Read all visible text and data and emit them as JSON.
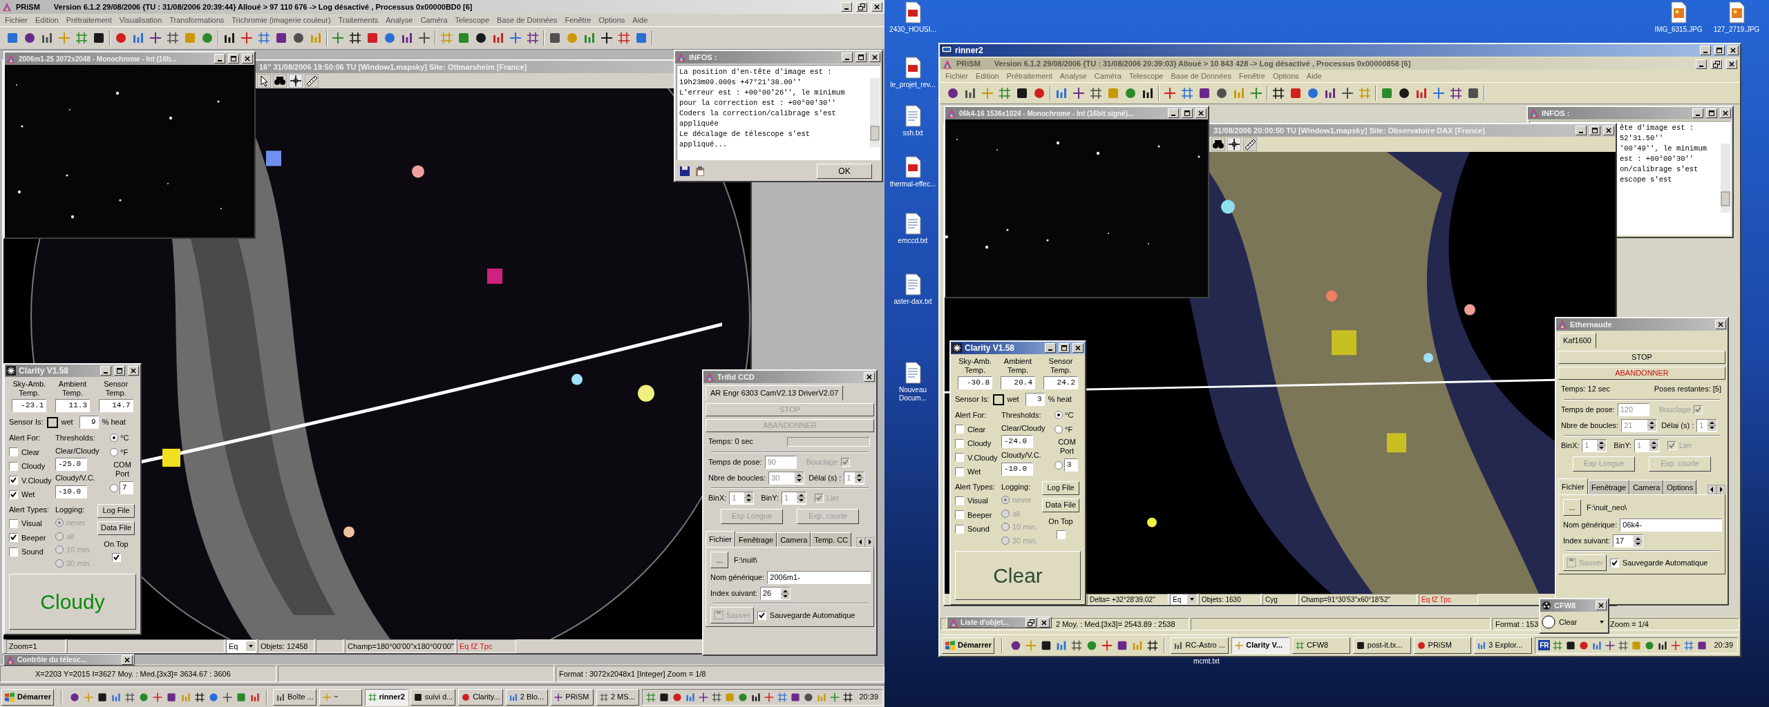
{
  "screens": [
    {
      "app": {
        "name": "PRiSM",
        "title": "Version 6.1.2   29/08/2006   {TU : 31/08/2006 20:39:44} Alloué > 97 110 676 -> Log désactivé , Processus 0x00000BD0 [6]",
        "menu": [
          "Fichier",
          "Edition",
          "Prétraitement",
          "Visualisation",
          "Transformations",
          "Trichromie (imagerie couleur)",
          "Traitements",
          "Analyse",
          "Caméra",
          "Telescope",
          "Base de Données",
          "Fenêtre",
          "Options",
          "Aide"
        ]
      },
      "map_window": {
        "title": "16\"  31/08/2006 19:50:06 TU [Window1.mapsky]  Site: Ottmarsheim [France]",
        "status": [
          {
            "text": "Zoom=1",
            "kind": "text"
          },
          {
            "text": "Eq",
            "kind": "dropdown"
          },
          {
            "text": "Objets: 12458",
            "kind": "text"
          },
          {
            "text": "Champ=180°00'00\"x180°00'00\"",
            "kind": "text"
          },
          {
            "text": "Eq fZ Tpc",
            "kind": "alert"
          }
        ]
      },
      "image_window": {
        "title": "2006m1-25 3072x2048 - Monochrome - Int (16b..."
      },
      "infos": {
        "title": "INFOS :",
        "lines": [
          "La position d'en-tête d'image est :",
          "19h23m09.000s +47°21'38.00''",
          "L'erreur est : +00°00'26'', le minimum",
          "pour la correction est : +00°00'30''",
          "Coders la correction/calibrage s'est",
          "appliquée",
          "Le décalage de télescope s'est",
          "appliqué..."
        ],
        "ok": "OK"
      },
      "clarity": {
        "title": "Clarity  V1.58",
        "temps": [
          {
            "label": "Sky-Amb. Temp.",
            "value": "-23.1"
          },
          {
            "label": "Ambient Temp.",
            "value": "11.3"
          },
          {
            "label": "Sensor Temp.",
            "value": "14.7"
          }
        ],
        "sensor_label": "Sensor Is:",
        "wet_label": "wet",
        "heat": "9",
        "heat_label": "% heat",
        "alert_for": {
          "label": "Alert For:",
          "items": [
            {
              "label": "Clear",
              "checked": false
            },
            {
              "label": "Cloudy",
              "checked": false
            },
            {
              "label": "V.Cloudy",
              "checked": true
            },
            {
              "label": "Wet",
              "checked": true
            }
          ]
        },
        "thresholds": {
          "label": "Thresholds:",
          "clear_cloudy_label": "Clear/Cloudy",
          "clear_cloudy": "-25.0",
          "cloudy_vc_label": "Cloudy/V.C.",
          "cloudy_vc": "-10.0"
        },
        "units": [
          {
            "label": "°C",
            "selected": true
          },
          {
            "label": "°F",
            "selected": false
          }
        ],
        "com_label": "COM Port",
        "com_selected": false,
        "com": "7",
        "alert_types": {
          "label": "Alert Types:",
          "items": [
            {
              "label": "Visual",
              "checked": false
            },
            {
              "label": "Beeper",
              "checked": true
            },
            {
              "label": "Sound",
              "checked": false
            }
          ]
        },
        "logging": {
          "label": "Logging:",
          "disabled": true,
          "items": [
            {
              "label": "never",
              "selected": true
            },
            {
              "label": "all",
              "selected": false
            },
            {
              "label": "10 min.",
              "selected": false
            },
            {
              "label": "30 min.",
              "selected": false
            }
          ]
        },
        "buttons": [
          "Log File",
          "Data File"
        ],
        "on_top": {
          "label": "On Top",
          "checked": true
        },
        "status": "Cloudy"
      },
      "camera": {
        "title": "Trifid CCD",
        "tab": "AR Engr 6303 CamV2.13 DriverV2.07",
        "buttons": [
          {
            "label": "STOP",
            "kind": "stop",
            "disabled": true
          },
          {
            "label": "ABANDONNER",
            "kind": "abort",
            "disabled": true
          }
        ],
        "time": "Temps:  0 sec",
        "progress": {
          "level": 0
        },
        "exposure_label": "Temps de pose:",
        "exposure": "90",
        "loop_label": "Bouclage",
        "loop": true,
        "count_label": "Nbre de boucles:",
        "count": "30",
        "delay_label": "Délai (s) :",
        "delay": "1",
        "binx_label": "BinX:",
        "binx": "1",
        "biny_label": "BinY:",
        "biny": "1",
        "link_label": "Lier",
        "link": true,
        "exp_buttons": [
          "Exp Longue",
          "Exp. courte"
        ],
        "tabs": [
          {
            "label": "Fichier",
            "selected": true
          },
          {
            "label": "Fenêtrage",
            "selected": false
          },
          {
            "label": "Camera",
            "selected": false
          },
          {
            "label": "Temp. CC",
            "selected": false
          }
        ],
        "browse": "...",
        "path": "F:\\nuit\\",
        "name_label": "Nom générique:",
        "name": "2006m1-",
        "index_label": "Index suivant:",
        "index": "26",
        "save": "Sauver",
        "autosave_label": "Sauvegarde Automatique",
        "autosave": true
      },
      "minimized": [
        {
          "title": "Contrôle du télesc..."
        }
      ],
      "status_bar": [
        "X=2203 Y=2015 I=3627  Moy. : Med.[3x3]= 3634.67 : 3606",
        "Format : 3072x2048x1 [Integer]  Zoom = 1/8"
      ],
      "taskbar": {
        "start": "Démarrer",
        "tasks": [
          {
            "label": "Boîte ...",
            "selected": false
          },
          {
            "label": "~",
            "selected": false
          },
          {
            "label": "rinner2",
            "selected": true
          },
          {
            "label": "suivi d...",
            "selected": false
          },
          {
            "label": "Clarity...",
            "selected": false
          },
          {
            "label": "2 Blo...",
            "selected": false
          },
          {
            "label": "PRiSM",
            "selected": false
          },
          {
            "label": "2 MS...",
            "selected": false
          }
        ],
        "time": "20:39"
      }
    },
    {
      "vnc_window": {
        "title": "rinner2"
      },
      "app": {
        "name": "PRiSM",
        "title": "Version 6.1.2   29/08/2006   {TU : 31/08/2006 20:39:03} Alloué > 10 843 428 -> Log désactivé , Processus 0x00000858 [6]",
        "menu": [
          "Fichier",
          "Edition",
          "Prétraitement",
          "Analyse",
          "Caméra",
          "Telescope",
          "Base de Données",
          "Fenêtre",
          "Options",
          "Aide"
        ]
      },
      "infos": {
        "title": "INFOS :",
        "lines": [
          "ête d'image est :",
          "52'31.50''",
          "'00'49'', le minimum",
          "est : +00°00'30''",
          "on/calibrage s'est",
          "escope s'est"
        ]
      },
      "map_window": {
        "title": "31/08/2006 20:00:50 TU [Window1.mapsky]  Site: Observatoire DAX [France]",
        "status": [
          {
            "text": "Delta= +32°28'39.02''",
            "kind": "text"
          },
          {
            "text": "Eq",
            "kind": "dropdown"
          },
          {
            "text": "Objets: 1630",
            "kind": "text"
          },
          {
            "text": "Cyg",
            "kind": "text"
          },
          {
            "text": "Champ=91°30'53''x60°18'52''",
            "kind": "text"
          },
          {
            "text": "Eq fZ Tpc",
            "kind": "alert"
          }
        ]
      },
      "image_window": {
        "title": "06k4-16 1536x1024 - Monochrome - Int (16bit signé)..."
      },
      "clarity": {
        "title": "Clarity  V1.58",
        "temps": [
          {
            "label": "Sky-Amb. Temp.",
            "value": "-30.8"
          },
          {
            "label": "Ambient Temp.",
            "value": "20.4"
          },
          {
            "label": "Sensor Temp.",
            "value": "24.2"
          }
        ],
        "sensor_label": "Sensor Is:",
        "wet_label": "wet",
        "heat": "3",
        "heat_label": "% heat",
        "alert_for": {
          "label": "Alert For:",
          "items": [
            {
              "label": "Clear",
              "checked": false
            },
            {
              "label": "Cloudy",
              "checked": false
            },
            {
              "label": "V.Cloudy",
              "checked": false
            },
            {
              "label": "Wet",
              "checked": false
            }
          ]
        },
        "thresholds": {
          "label": "Thresholds:",
          "clear_cloudy_label": "Clear/Cloudy",
          "clear_cloudy": "-24.0",
          "cloudy_vc_label": "Cloudy/V.C.",
          "cloudy_vc": "-10.0"
        },
        "units": [
          {
            "label": "°C",
            "selected": true
          },
          {
            "label": "°F",
            "selected": false
          }
        ],
        "com_label": "COM Port",
        "com_selected": false,
        "com": "3",
        "alert_types": {
          "label": "Alert Types:",
          "items": [
            {
              "label": "Visual",
              "checked": false
            },
            {
              "label": "Beeper",
              "checked": false
            },
            {
              "label": "Sound",
              "checked": false
            }
          ]
        },
        "logging": {
          "label": "Logging:",
          "disabled": true,
          "items": [
            {
              "label": "never",
              "selected": true
            },
            {
              "label": "all",
              "selected": false
            },
            {
              "label": "10 min.",
              "selected": false
            },
            {
              "label": "30 min.",
              "selected": false
            }
          ]
        },
        "buttons": [
          "Log File",
          "Data File"
        ],
        "on_top": {
          "label": "On Top",
          "checked": false
        },
        "status": "Clear"
      },
      "camera": {
        "title": "Ethernaude",
        "tab": "Kaf1600",
        "buttons": [
          {
            "label": "STOP",
            "kind": "stop",
            "disabled": false
          },
          {
            "label": "ABANDONNER",
            "kind": "abort",
            "disabled": false
          }
        ],
        "time": "Temps:  12 sec",
        "remaining": "Poses restantes: [5]",
        "exposure_label": "Temps de pose:",
        "exposure": "120",
        "loop_label": "Bouclage",
        "loop": true,
        "count_label": "Nbre de boucles:",
        "count": "21",
        "delay_label": "Délai (s) :",
        "delay": "1",
        "binx_label": "BinX:",
        "binx": "1",
        "biny_label": "BinY:",
        "biny": "1",
        "link_label": "Lier",
        "link": true,
        "exp_buttons": [
          "Exp Longue",
          "Exp. courte"
        ],
        "tabs": [
          {
            "label": "Fichier",
            "selected": true
          },
          {
            "label": "Fenêtrage",
            "selected": false
          },
          {
            "label": "Camera",
            "selected": false
          },
          {
            "label": "Options",
            "selected": false
          }
        ],
        "browse": "...",
        "path": "F:\\nuit_neo\\",
        "name_label": "Nom générique:",
        "name": "06k4-",
        "index_label": "Index suivant:",
        "index": "17",
        "save": "Sauver",
        "autosave_label": "Sauvegarde Automatique",
        "autosave": true
      },
      "minimized": [
        {
          "title": "Liste d'objet..."
        }
      ],
      "status_bar": [
        "2  Moy. : Med.[3x3]= 2543.89 : 2538",
        "Format : 153",
        "Zoom = 1/4"
      ],
      "filter_wheel": {
        "title": "CFW8",
        "value": "Clear"
      },
      "taskbar": {
        "start": "Démarrer",
        "tasks": [
          {
            "label": "RC-Astro ...",
            "selected": false
          },
          {
            "label": "Clarity V...",
            "selected": true
          },
          {
            "label": "CFW8",
            "selected": false
          },
          {
            "label": "post-it.tx...",
            "selected": false
          },
          {
            "label": "PRiSM",
            "selected": false
          },
          {
            "label": "3 Explor...",
            "selected": false
          }
        ],
        "language": "FR",
        "time": "20:39"
      },
      "desktop_icons": [
        {
          "label": "2430_HOUSI...",
          "kind": "pdf"
        },
        {
          "label": "le_projet_rev...",
          "kind": "pdf"
        },
        {
          "label": "ssh.txt",
          "kind": "txt"
        },
        {
          "label": "thermal-effec...",
          "kind": "pdf"
        },
        {
          "label": "emccd.txt",
          "kind": "txt"
        },
        {
          "label": "aster-dax.txt",
          "kind": "txt"
        },
        {
          "label": "Nouveau Docum...",
          "kind": "txt"
        },
        {
          "label": "IMG_6315.JPG",
          "kind": "jpg"
        },
        {
          "label": "127_2719.JPG",
          "kind": "jpg"
        },
        {
          "label": "mcmt.txt",
          "kind": "covered"
        }
      ]
    }
  ]
}
